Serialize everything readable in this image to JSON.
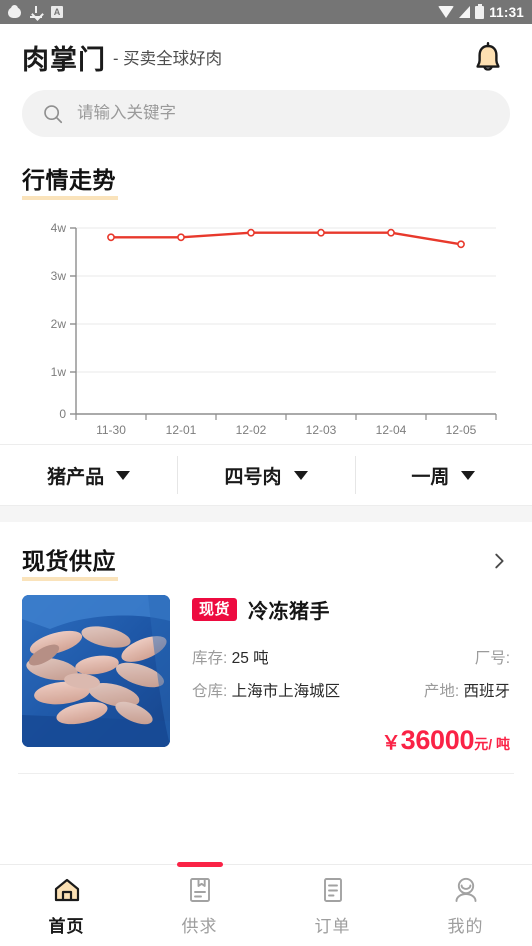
{
  "statusbar": {
    "time": "11:31",
    "left_icons": [
      "cloud-icon",
      "download-icon",
      "a-box-icon"
    ],
    "right_icons": [
      "wifi-icon",
      "signal-icon",
      "battery-icon"
    ]
  },
  "header": {
    "brand": "肉掌门",
    "slogan": "- 买卖全球好肉",
    "notification_icon": "bell-icon"
  },
  "search": {
    "placeholder": "请输入关键字",
    "value": "",
    "icon": "search-icon"
  },
  "market": {
    "title": "行情走势"
  },
  "chart_data": {
    "type": "line",
    "title": "行情走势",
    "x": [
      "11-30",
      "12-01",
      "12-02",
      "12-03",
      "12-04",
      "12-05"
    ],
    "categories": [
      "11-30",
      "12-01",
      "12-02",
      "12-03",
      "12-04",
      "12-05"
    ],
    "values": [
      38000,
      38000,
      39000,
      39000,
      39000,
      36500
    ],
    "series": [
      {
        "name": "四号肉",
        "values": [
          38000,
          38000,
          39000,
          39000,
          39000,
          36500
        ]
      }
    ],
    "ytick_labels": [
      "0",
      "1w",
      "2w",
      "3w",
      "4w"
    ],
    "ytick_values": [
      0,
      10000,
      20000,
      30000,
      40000
    ],
    "ylim": [
      0,
      40000
    ],
    "xlabel": "",
    "ylabel": "",
    "grid": true,
    "legend": "none",
    "line_color": "#e8392c",
    "marker": "open-circle"
  },
  "filters": [
    {
      "label": "猪产品",
      "icon": "chevron-down-icon"
    },
    {
      "label": "四号肉",
      "icon": "chevron-down-icon"
    },
    {
      "label": "一周",
      "icon": "chevron-down-icon"
    }
  ],
  "supply": {
    "title": "现货供应",
    "more_icon": "chevron-right-icon",
    "items": [
      {
        "badge": "现货",
        "title": "冷冻猪手",
        "stock_label": "库存:",
        "stock_value": "25 吨",
        "factory_label": "厂号:",
        "factory_value": "",
        "warehouse_label": "仓库:",
        "warehouse_value": "上海市上海城区",
        "origin_label": "产地:",
        "origin_value": "西班牙",
        "currency": "￥",
        "price": "36000",
        "unit": "元/ 吨",
        "image": "frozen-pig-trotters-in-blue-bag"
      }
    ]
  },
  "tabbar": {
    "items": [
      {
        "label": "首页",
        "icon": "home-icon",
        "active": true,
        "indicator": false
      },
      {
        "label": "供求",
        "icon": "supply-demand-icon",
        "active": false,
        "indicator": true
      },
      {
        "label": "订单",
        "icon": "order-icon",
        "active": false,
        "indicator": false
      },
      {
        "label": "我的",
        "icon": "profile-icon",
        "active": false,
        "indicator": false
      }
    ]
  },
  "colors": {
    "accent_red": "#fa2346",
    "badge_red": "#ed0b40",
    "chart_line": "#e8392c",
    "underline_cream": "#fae3bb",
    "statusbar_gray": "#757575"
  }
}
